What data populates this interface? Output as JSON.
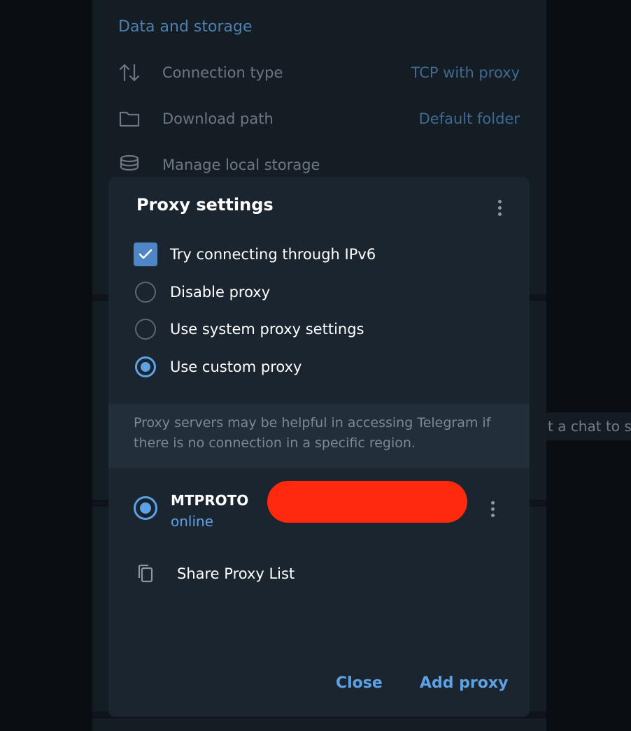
{
  "background": {
    "section_title": "Data and storage",
    "rows": [
      {
        "icon": "arrows-up-down-icon",
        "label": "Connection type",
        "value": "TCP with proxy"
      },
      {
        "icon": "folder-icon",
        "label": "Download path",
        "value": "Default folder"
      },
      {
        "icon": "database-icon",
        "label": "Manage local storage",
        "value": ""
      }
    ],
    "side_text": "t a chat to s"
  },
  "dialog": {
    "title": "Proxy settings",
    "options": [
      {
        "type": "checkbox",
        "label": "Try connecting through IPv6",
        "checked": true
      },
      {
        "type": "radio",
        "label": "Disable proxy",
        "selected": false
      },
      {
        "type": "radio",
        "label": "Use system proxy settings",
        "selected": false
      },
      {
        "type": "radio",
        "label": "Use custom proxy",
        "selected": true
      }
    ],
    "info_text": "Proxy servers may be helpful in accessing Telegram if there is no connection in a specific region.",
    "proxy": {
      "name": "MTPROTO",
      "status": "online",
      "selected": true
    },
    "share_label": "Share Proxy List",
    "close_label": "Close",
    "add_label": "Add proxy"
  },
  "colors": {
    "accent": "#5ea2e6",
    "checkbox": "#4f86c6",
    "redaction": "#ff2a0e",
    "dialog_bg": "#1b2530"
  }
}
